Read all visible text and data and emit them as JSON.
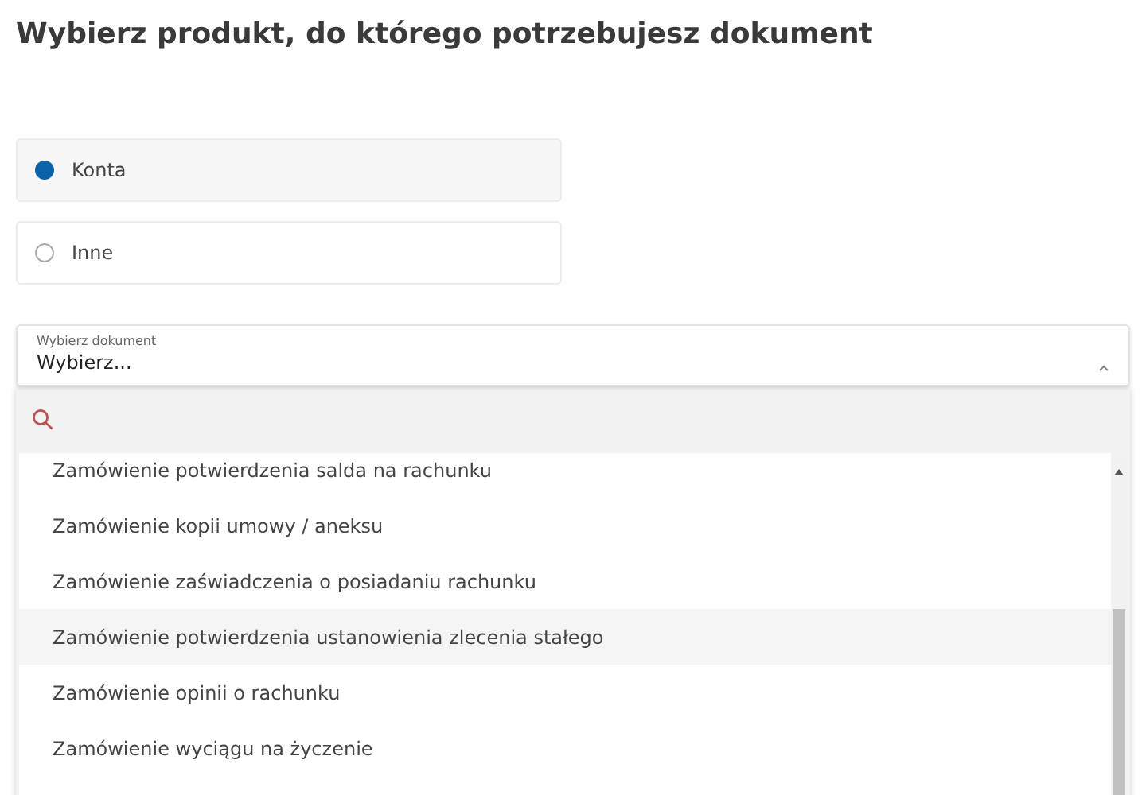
{
  "heading": "Wybierz produkt, do którego potrzebujesz dokument",
  "product_options": [
    {
      "label": "Konta",
      "selected": true
    },
    {
      "label": "Inne",
      "selected": false
    }
  ],
  "document_select": {
    "label": "Wybierz dokument",
    "value": "Wybierz...",
    "expanded": true
  },
  "dropdown_items": [
    {
      "label": "Zamówienie potwierdzenia salda na rachunku",
      "selected": false
    },
    {
      "label": "Zamówienie kopii umowy / aneksu",
      "selected": false
    },
    {
      "label": "Zamówienie zaświadczenia o posiadaniu rachunku",
      "selected": false
    },
    {
      "label": "Zamówienie potwierdzenia ustanowienia zlecenia stałego",
      "selected": true
    },
    {
      "label": "Zamówienie opinii o rachunku",
      "selected": false
    },
    {
      "label": "Zamówienie wyciągu na życzenie",
      "selected": false
    }
  ]
}
